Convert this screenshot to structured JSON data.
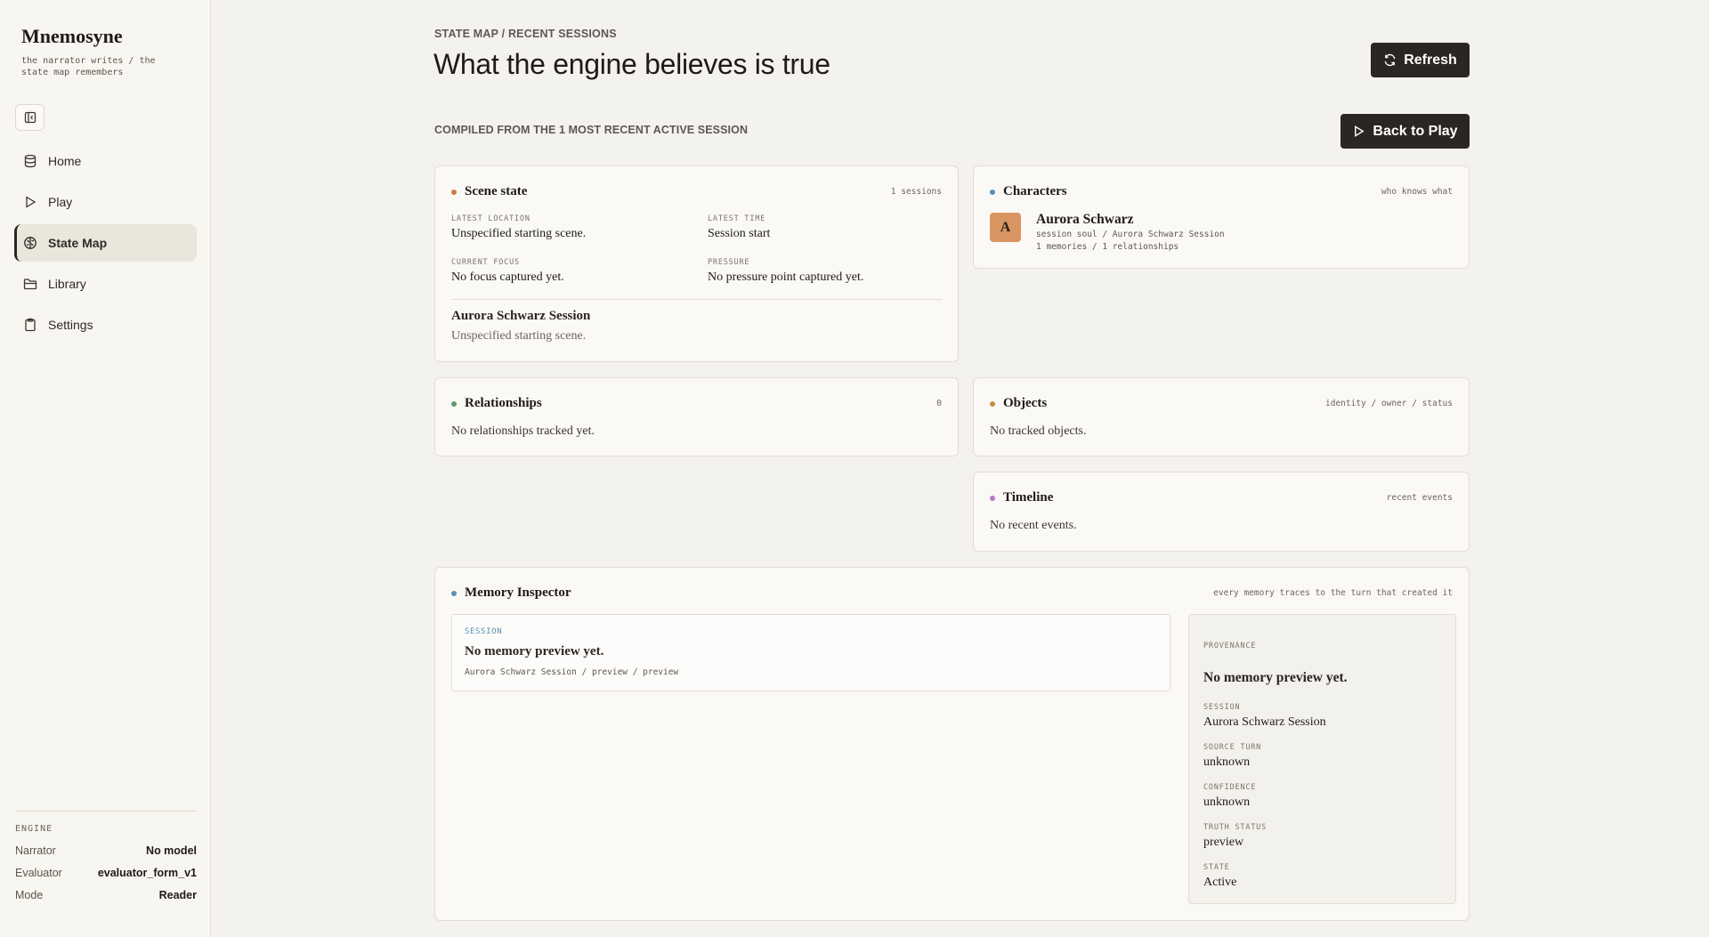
{
  "sidebar": {
    "brand": "Mnemosyne",
    "tagline": "the narrator writes / the state map remembers",
    "nav": [
      {
        "label": "Home",
        "icon": "database-icon"
      },
      {
        "label": "Play",
        "icon": "play-icon"
      },
      {
        "label": "State Map",
        "icon": "brain-icon",
        "active": true
      },
      {
        "label": "Library",
        "icon": "folder-icon"
      },
      {
        "label": "Settings",
        "icon": "clipboard-icon"
      }
    ],
    "engine": {
      "title": "ENGINE",
      "rows": [
        {
          "label": "Narrator",
          "value": "No model"
        },
        {
          "label": "Evaluator",
          "value": "evaluator_form_v1"
        },
        {
          "label": "Mode",
          "value": "Reader"
        }
      ]
    }
  },
  "header": {
    "breadcrumb": "STATE MAP / RECENT SESSIONS",
    "title": "What the engine believes is true",
    "refresh_label": "Refresh",
    "back_label": "Back to Play",
    "compiled": "COMPILED FROM THE 1 MOST RECENT ACTIVE SESSION"
  },
  "scene": {
    "title": "Scene state",
    "meta": "1 sessions",
    "dot_color": "#c97a45",
    "latest_location_label": "LATEST LOCATION",
    "latest_location": "Unspecified starting scene.",
    "latest_time_label": "LATEST TIME",
    "latest_time": "Session start",
    "current_focus_label": "CURRENT FOCUS",
    "current_focus": "No focus captured yet.",
    "pressure_label": "PRESSURE",
    "pressure": "No pressure point captured yet.",
    "session_name": "Aurora Schwarz Session",
    "session_location": "Unspecified starting scene."
  },
  "characters": {
    "title": "Characters",
    "meta": "who knows what",
    "dot_color": "#5b8fb5",
    "avatar_letter": "A",
    "name": "Aurora Schwarz",
    "sub1": "session soul / Aurora Schwarz Session",
    "sub2": "1 memories / 1 relationships"
  },
  "relationships": {
    "title": "Relationships",
    "meta": "0",
    "dot_color": "#5e9a6c",
    "empty": "No relationships tracked yet."
  },
  "objects": {
    "title": "Objects",
    "meta": "identity / owner / status",
    "dot_color": "#c98a45",
    "empty": "No tracked objects."
  },
  "timeline": {
    "title": "Timeline",
    "meta": "recent events",
    "dot_color": "#b477c9",
    "empty": "No recent events."
  },
  "memory": {
    "title": "Memory Inspector",
    "meta": "every memory traces to the turn that created it",
    "dot_color": "#5b8fb5",
    "card_tag": "SESSION",
    "card_title": "No memory preview yet.",
    "card_sub": "Aurora Schwarz Session / preview / preview",
    "provenance": {
      "label": "PROVENANCE",
      "title": "No memory preview yet.",
      "session_label": "SESSION",
      "session": "Aurora Schwarz Session",
      "source_turn_label": "SOURCE TURN",
      "source_turn": "unknown",
      "confidence_label": "CONFIDENCE",
      "confidence": "unknown",
      "truth_status_label": "TRUTH STATUS",
      "truth_status": "preview",
      "state_label": "STATE",
      "state": "Active"
    }
  }
}
